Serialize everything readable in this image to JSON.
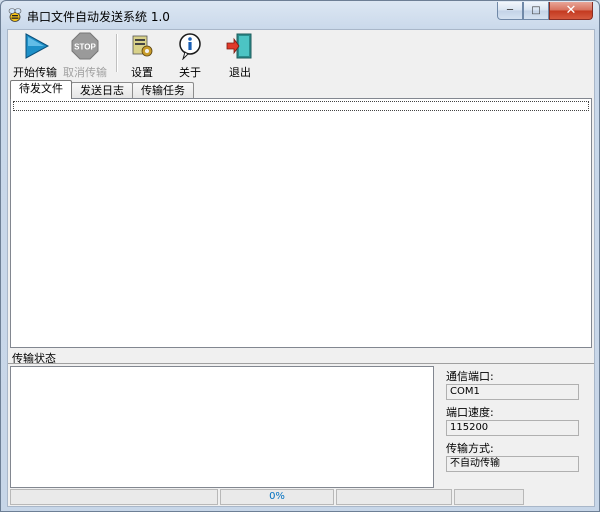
{
  "window": {
    "title": "串口文件自动发送系统 1.0",
    "controls": {
      "minimize": "─",
      "maximize": "□",
      "close": "✕"
    }
  },
  "toolbar": {
    "items": [
      {
        "label": "开始传输",
        "icon": "play-icon",
        "enabled": true
      },
      {
        "label": "取消传输",
        "icon": "stop-icon",
        "enabled": false
      },
      {
        "label": "设置",
        "icon": "settings-icon",
        "enabled": true
      },
      {
        "label": "关于",
        "icon": "info-icon",
        "enabled": true
      },
      {
        "label": "退出",
        "icon": "exit-door-icon",
        "enabled": true
      }
    ]
  },
  "tabs": [
    {
      "label": "待发文件",
      "active": true
    },
    {
      "label": "发送日志",
      "active": false
    },
    {
      "label": "传输任务",
      "active": false
    }
  ],
  "status_section": {
    "label": "传输状态"
  },
  "info": {
    "port_label": "通信端口:",
    "port_value": "COM1",
    "speed_label": "端口速度:",
    "speed_value": "115200",
    "mode_label": "传输方式:",
    "mode_value": "不自动传输"
  },
  "statusbar": {
    "progress_text": "0%"
  },
  "colors": {
    "progress_text": "#0070c0",
    "title_bar": "#dce7f3",
    "play_icon": "#1e90c8",
    "stop_icon": "#9a9a9a"
  }
}
